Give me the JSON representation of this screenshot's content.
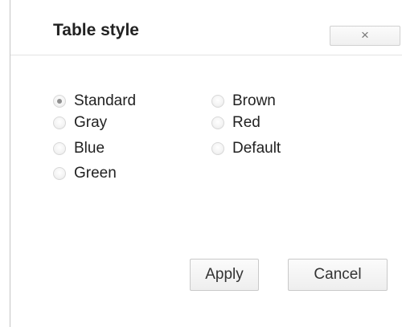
{
  "dialog": {
    "title": "Table style",
    "close_label": "×"
  },
  "options": [
    {
      "label": "Standard",
      "checked": true
    },
    {
      "label": "Gray",
      "checked": false
    },
    {
      "label": "Blue",
      "checked": false
    },
    {
      "label": "Green",
      "checked": false
    },
    {
      "label": "Brown",
      "checked": false
    },
    {
      "label": "Red",
      "checked": false
    },
    {
      "label": "Default",
      "checked": false
    }
  ],
  "buttons": {
    "apply": "Apply",
    "cancel": "Cancel"
  }
}
